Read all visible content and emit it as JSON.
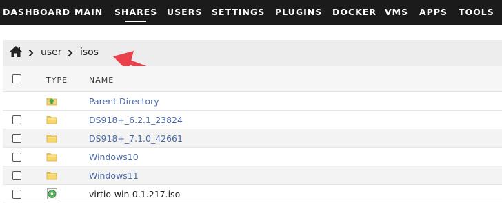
{
  "nav": {
    "items": [
      "DASHBOARD",
      "MAIN",
      "SHARES",
      "USERS",
      "SETTINGS",
      "PLUGINS",
      "DOCKER",
      "VMS",
      "APPS",
      "TOOLS"
    ],
    "active": "SHARES",
    "bg_color": "#1c1b1b"
  },
  "breadcrumb": {
    "home_icon": "home-icon",
    "parts": [
      "user",
      "isos"
    ]
  },
  "annotation": {
    "color": "#e9424b",
    "icon": "arrow-annotation"
  },
  "table": {
    "headers": {
      "type": "TYPE",
      "name": "NAME"
    },
    "parent": {
      "label": "Parent Directory",
      "icon": "folder-up-icon"
    },
    "rows": [
      {
        "name": "DS918+_6.2.1_23824",
        "icon": "folder-icon",
        "kind": "folder"
      },
      {
        "name": "DS918+_7.1.0_42661",
        "icon": "folder-icon",
        "kind": "folder"
      },
      {
        "name": "Windows10",
        "icon": "folder-icon",
        "kind": "folder"
      },
      {
        "name": "Windows11",
        "icon": "folder-icon",
        "kind": "folder"
      },
      {
        "name": "virtio-win-0.1.217.iso",
        "icon": "disc-image-icon",
        "kind": "file"
      }
    ]
  }
}
